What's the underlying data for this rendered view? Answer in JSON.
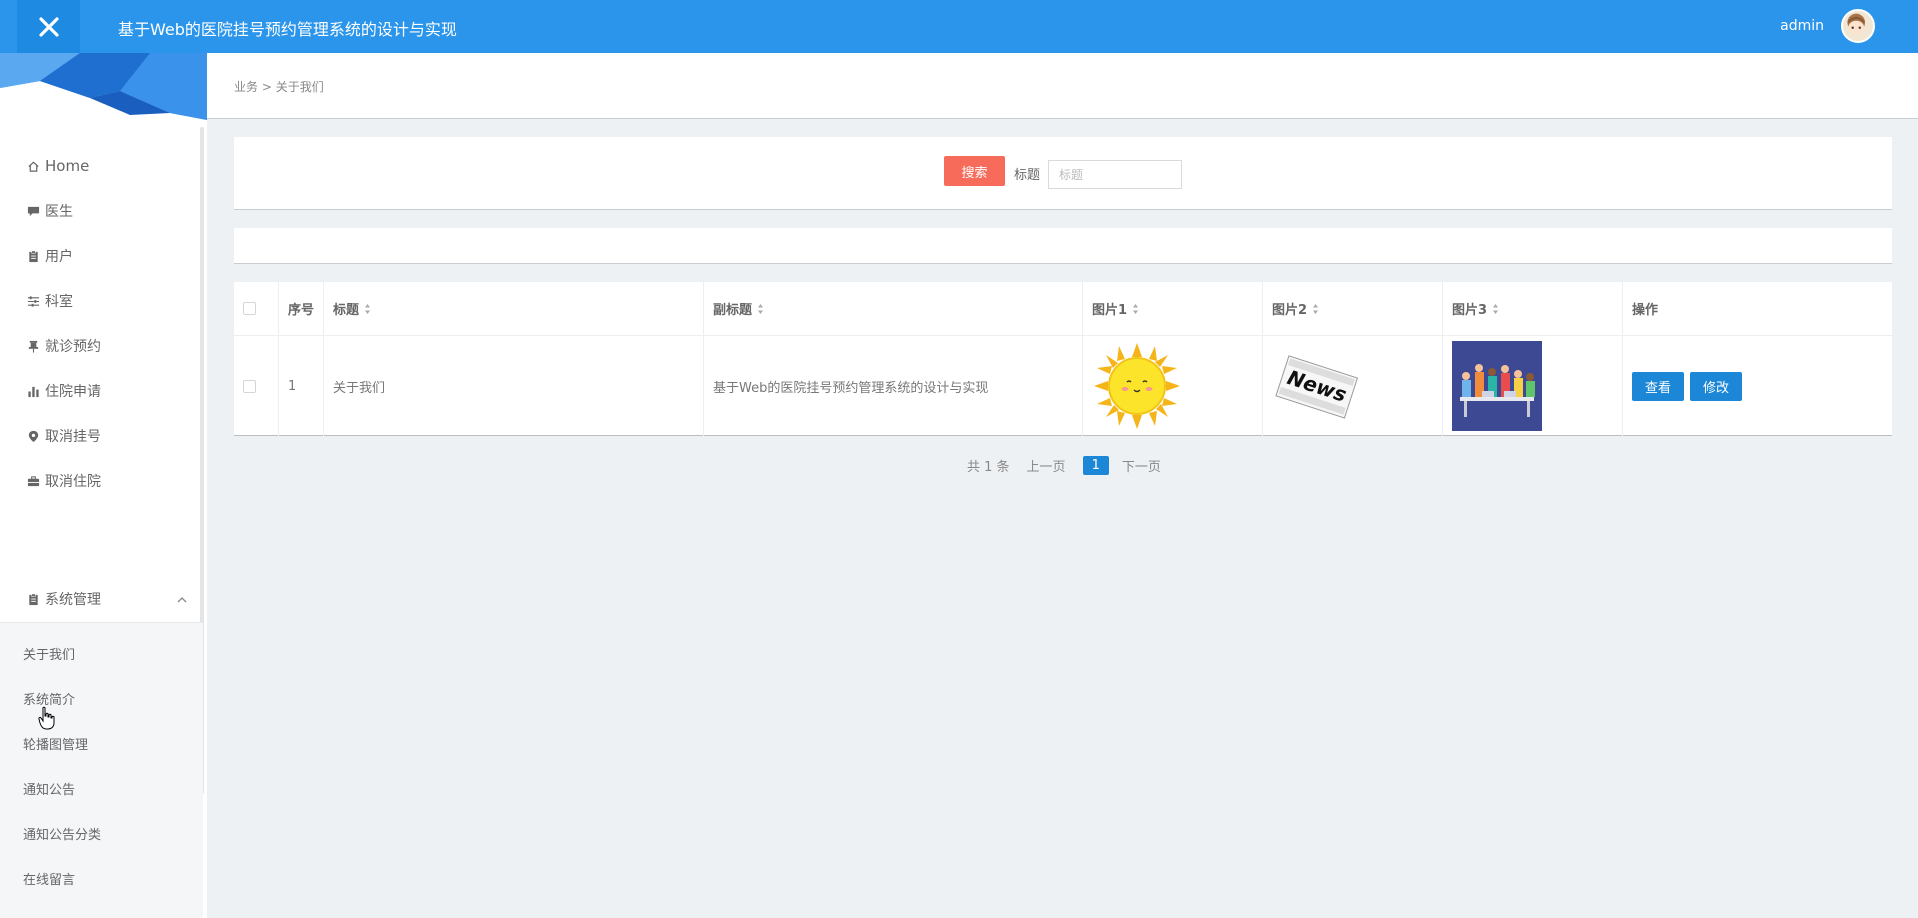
{
  "header": {
    "app_title": "基于Web的医院挂号预约管理系统的设计与实现",
    "user_name": "admin",
    "accent_color": "#2a95ea"
  },
  "sidebar": {
    "items": [
      {
        "label": "Home",
        "icon": "home-icon"
      },
      {
        "label": "医生",
        "icon": "comment-icon"
      },
      {
        "label": "用户",
        "icon": "clipboard-icon"
      },
      {
        "label": "科室",
        "icon": "sliders-icon"
      },
      {
        "label": "就诊预约",
        "icon": "pushpin-icon"
      },
      {
        "label": "住院申请",
        "icon": "bar-chart-icon"
      },
      {
        "label": "取消挂号",
        "icon": "location-icon"
      },
      {
        "label": "取消住院",
        "icon": "briefcase-icon"
      },
      {
        "label": "系统管理",
        "icon": "clipboard-icon"
      }
    ],
    "submenu": [
      "关于我们",
      "系统简介",
      "轮播图管理",
      "通知公告",
      "通知公告分类",
      "在线留言"
    ]
  },
  "breadcrumb": {
    "parent": "业务",
    "separator": ">",
    "current": "关于我们"
  },
  "search": {
    "button_label": "搜索",
    "field_label": "标题",
    "placeholder": "标题",
    "button_color": "#f76b5b"
  },
  "table": {
    "headers": [
      "序号",
      "标题",
      "副标题",
      "图片1",
      "图片2",
      "图片3",
      "操作"
    ],
    "rows": [
      {
        "index": "1",
        "title": "关于我们",
        "subtitle": "基于Web的医院挂号预约管理系统的设计与实现",
        "image1": "sun-image",
        "image2": "news-image",
        "image3": "people-image",
        "image2_text": "News",
        "actions": {
          "view": "查看",
          "edit": "修改"
        }
      }
    ]
  },
  "pagination": {
    "total": "共 1 条",
    "prev": "上一页",
    "current": "1",
    "next": "下一页"
  }
}
